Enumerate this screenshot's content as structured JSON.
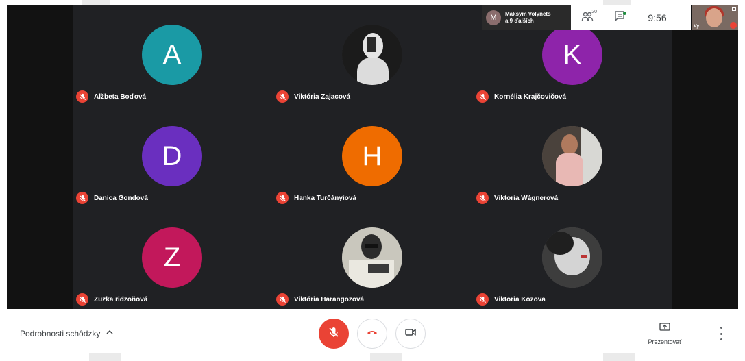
{
  "participants_chip": {
    "initial": "M",
    "line1": "Maksym Volynets",
    "line2": "a 9 ďalších"
  },
  "people_count": "20",
  "clock": "9:56",
  "self_view_label": "Vy",
  "tiles": [
    {
      "name": "Alžbeta Boďová",
      "initial": "A",
      "color": "#1a9aa5",
      "photo": false
    },
    {
      "name": "Viktória Zajacová",
      "initial": "",
      "color": "#3a3a3a",
      "photo": true
    },
    {
      "name": "Kornélia Krajčovičová",
      "initial": "K",
      "color": "#8e24aa",
      "photo": false
    },
    {
      "name": "Danica Gondová",
      "initial": "D",
      "color": "#6a2fbf",
      "photo": false
    },
    {
      "name": "Hanka Turčányiová",
      "initial": "H",
      "color": "#ef6c00",
      "photo": false
    },
    {
      "name": "Viktoria Wágnerová",
      "initial": "",
      "color": "#7a6b63",
      "photo": true
    },
    {
      "name": "Zuzka ridzoňová",
      "initial": "Z",
      "color": "#c2185b",
      "photo": false
    },
    {
      "name": "Viktória Harangozová",
      "initial": "",
      "color": "#8a8a82",
      "photo": true
    },
    {
      "name": "Viktoria Kozova",
      "initial": "",
      "color": "#5a5a5a",
      "photo": true
    }
  ],
  "bottom": {
    "meeting_details": "Podrobnosti schôdzky",
    "present_label": "Prezentovať"
  },
  "icons": {
    "mute": "mic-off-icon",
    "hangup": "phone-hangup-icon",
    "camera": "videocam-icon",
    "people": "people-icon",
    "chat": "chat-icon",
    "present": "present-screen-icon",
    "more": "more-vert-icon"
  },
  "colors": {
    "danger": "#ea4335",
    "grid_bg": "#202124"
  }
}
